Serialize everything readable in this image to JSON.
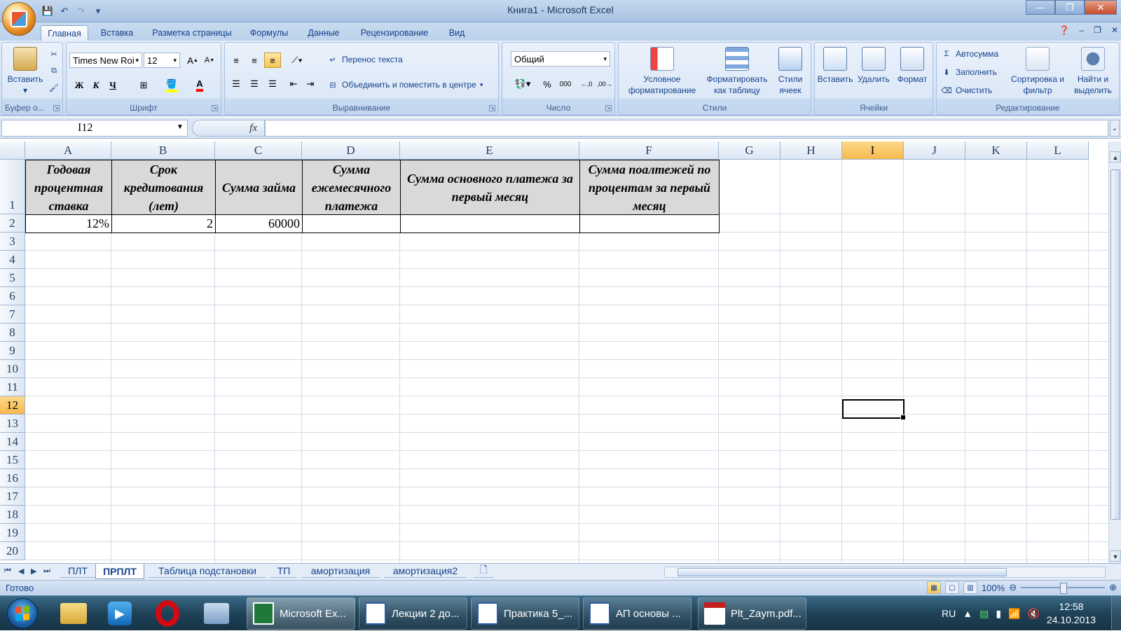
{
  "window": {
    "title": "Книга1 - Microsoft Excel",
    "minimize": "—",
    "restore": "❐",
    "close": "✕"
  },
  "qat": [
    "save-icon",
    "undo-icon",
    "redo-icon",
    "customize-icon"
  ],
  "tabs": [
    "Главная",
    "Вставка",
    "Разметка страницы",
    "Формулы",
    "Данные",
    "Рецензирование",
    "Вид"
  ],
  "ribbon": {
    "clipboard": {
      "label": "Буфер о...",
      "paste": "Вставить"
    },
    "font": {
      "label": "Шрифт",
      "name": "Times New Roi",
      "size": "12",
      "bold": "Ж",
      "italic": "К",
      "underline": "Ч"
    },
    "alignment": {
      "label": "Выравнивание",
      "wrap": "Перенос текста",
      "merge": "Объединить и поместить в центре"
    },
    "number": {
      "label": "Число",
      "format": "Общий",
      "percent": "%",
      "thousands": "000"
    },
    "styles": {
      "label": "Стили",
      "conditional": "Условное форматирование",
      "astable": "Форматировать как таблицу",
      "cellstyles": "Стили ячеек"
    },
    "cells": {
      "label": "Ячейки",
      "insert": "Вставить",
      "delete": "Удалить",
      "format": "Формат"
    },
    "editing": {
      "label": "Редактирование",
      "autosum": "Автосумма",
      "fill": "Заполнить",
      "clear": "Очистить",
      "sort": "Сортировка и фильтр",
      "find": "Найти и выделить"
    }
  },
  "formula": {
    "namebox": "I12",
    "fx": "fx",
    "value": ""
  },
  "columns": [
    "A",
    "B",
    "C",
    "D",
    "E",
    "F",
    "G",
    "H",
    "I",
    "J",
    "K",
    "L"
  ],
  "rows": [
    "1",
    "2",
    "3",
    "4",
    "5",
    "6",
    "7",
    "8",
    "9",
    "10",
    "11",
    "12",
    "13",
    "14",
    "15",
    "16",
    "17",
    "18",
    "19",
    "20"
  ],
  "selected": {
    "column": "I",
    "row": "12"
  },
  "table": {
    "headers": [
      "Годовая процентная ставка",
      "Срок кредитования (лет)",
      "Сумма займа",
      "Сумма ежемесячного платежа",
      "Сумма основного платежа за первый месяц",
      "Сумма поалтежей по процентам за первый месяц"
    ],
    "row2": [
      "12%",
      "2",
      "60000",
      "",
      "",
      ""
    ]
  },
  "sheets": [
    "ПЛТ",
    "ПРПЛТ",
    "Таблица подстановки",
    "ТП",
    "амортизация",
    "амортизация2"
  ],
  "active_sheet": "ПРПЛТ",
  "status": {
    "text": "Готово",
    "zoom": "100%"
  },
  "taskbar": {
    "items": [
      "Microsoft Ex...",
      "Лекции 2 до...",
      "Практика 5_...",
      "АП основы ...",
      "Plt_Zaym.pdf..."
    ],
    "lang": "RU",
    "time": "12:58",
    "date": "24.10.2013"
  },
  "colors": {
    "accent": "#15428b",
    "selection": "#f7b94d",
    "header_fill": "#d9d9d9"
  }
}
